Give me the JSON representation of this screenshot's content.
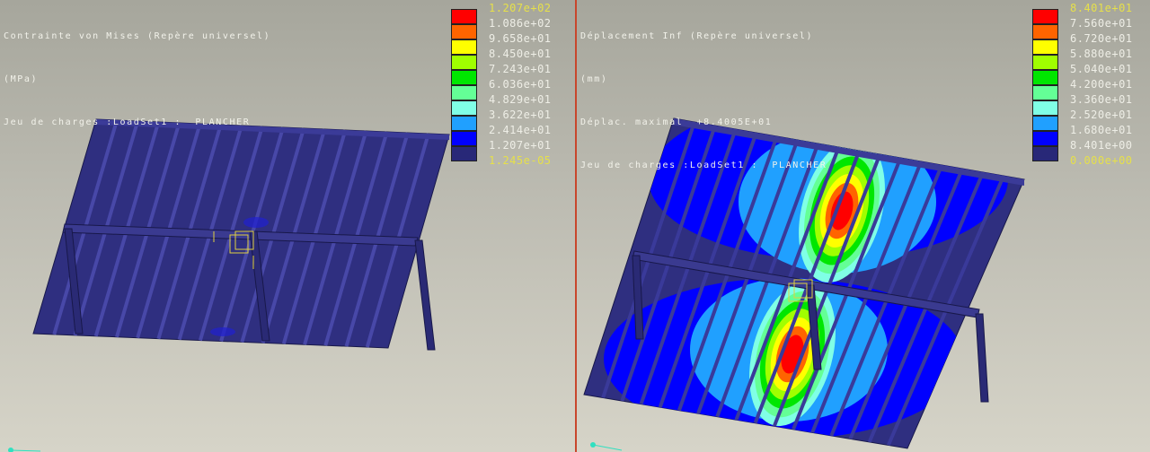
{
  "left_view": {
    "title": "Contrainte von Mises (Repère universel)",
    "unit": "(MPa)",
    "load_set": "Jeu de charges :LoadSet1 :  PLANCHER",
    "legend": {
      "max_label": "1.207e+02",
      "labels": [
        "1.086e+02",
        "9.658e+01",
        "8.450e+01",
        "7.243e+01",
        "6.036e+01",
        "4.829e+01",
        "3.622e+01",
        "2.414e+01",
        "1.207e+01"
      ],
      "min_label": "1.245e-05"
    }
  },
  "right_view": {
    "title": "Déplacement Inf (Repère universel)",
    "unit": "(mm)",
    "max_displacement": "Déplac. maximal  +8.4005E+01",
    "load_set": "Jeu de charges :LoadSet1 :  PLANCHER",
    "legend": {
      "max_label": "8.401e+01",
      "labels": [
        "7.560e+01",
        "6.720e+01",
        "5.880e+01",
        "5.040e+01",
        "4.200e+01",
        "3.360e+01",
        "2.520e+01",
        "1.680e+01",
        "8.401e+00"
      ],
      "min_label": "0.000e+00"
    }
  },
  "colors": {
    "scale": [
      "#ff0000",
      "#ff6400",
      "#ffff00",
      "#a0ff00",
      "#00e600",
      "#64ff96",
      "#80ffe6",
      "#20a0ff",
      "#0000ff",
      "#282878"
    ],
    "highlight_label": "#e6e04a",
    "divider": "#c8462c"
  }
}
